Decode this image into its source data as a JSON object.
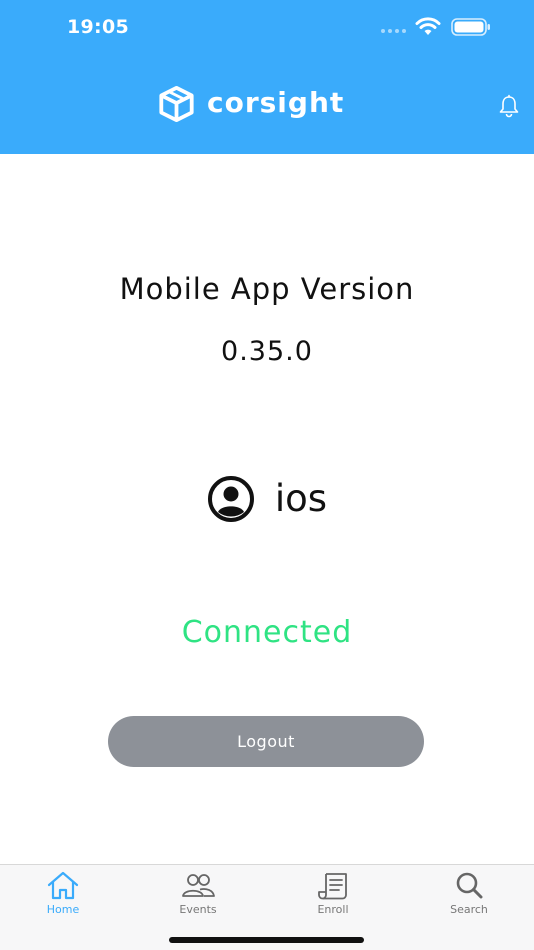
{
  "status_bar": {
    "time": "19:05"
  },
  "header": {
    "brand_name": "corsight",
    "brand_color": "#3aabfb",
    "icons": [
      "cube-logo-icon",
      "bell-icon"
    ]
  },
  "main": {
    "version_title": "Mobile App Version",
    "version_number": "0.35.0",
    "user_name": "ios",
    "user_icon": "user-circle-icon",
    "connection_status": "Connected",
    "connection_color": "#2fe383",
    "logout_label": "Logout"
  },
  "tab_bar": {
    "tabs": [
      {
        "label": "Home",
        "icon": "home-icon",
        "active": true
      },
      {
        "label": "Events",
        "icon": "people-icon",
        "active": false
      },
      {
        "label": "Enroll",
        "icon": "scroll-icon",
        "active": false
      },
      {
        "label": "Search",
        "icon": "search-icon",
        "active": false
      }
    ]
  }
}
